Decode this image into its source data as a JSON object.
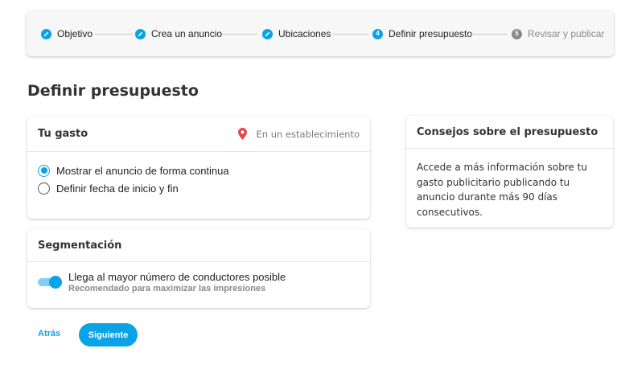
{
  "stepper": {
    "steps": [
      {
        "label": "Objetivo",
        "state": "done",
        "icon": "pencil-icon"
      },
      {
        "label": "Crea un anuncio",
        "state": "done",
        "icon": "pencil-icon"
      },
      {
        "label": "Ubicaciones",
        "state": "done",
        "icon": "pencil-icon"
      },
      {
        "label": "Definir presupuesto",
        "state": "current",
        "number": "4"
      },
      {
        "label": "Revisar y publicar",
        "state": "pending",
        "number": "5"
      }
    ]
  },
  "page": {
    "title": "Definir presupuesto"
  },
  "spend": {
    "title": "Tu gasto",
    "location_icon": "map-pin-icon",
    "location_text": "En un establecimiento",
    "options": [
      {
        "label": "Mostrar el anuncio de forma continua",
        "checked": true
      },
      {
        "label": "Definir fecha de inicio y fin",
        "checked": false
      }
    ]
  },
  "segmentation": {
    "title": "Segmentación",
    "toggle_on": true,
    "main_text": "Llega al mayor número de conductores posible",
    "sub_text": "Recomendado para maximizar las impresiones"
  },
  "tips": {
    "title": "Consejos sobre el presupuesto",
    "body": "Accede a más información sobre tu gasto publicitario publicando tu anuncio durante más 90 días consecutivos."
  },
  "footer": {
    "back_label": "Atrás",
    "next_label": "Siguiente"
  },
  "colors": {
    "accent": "#0aa3e8",
    "pin": "#e5484d",
    "inactive": "#8a8a8a"
  }
}
